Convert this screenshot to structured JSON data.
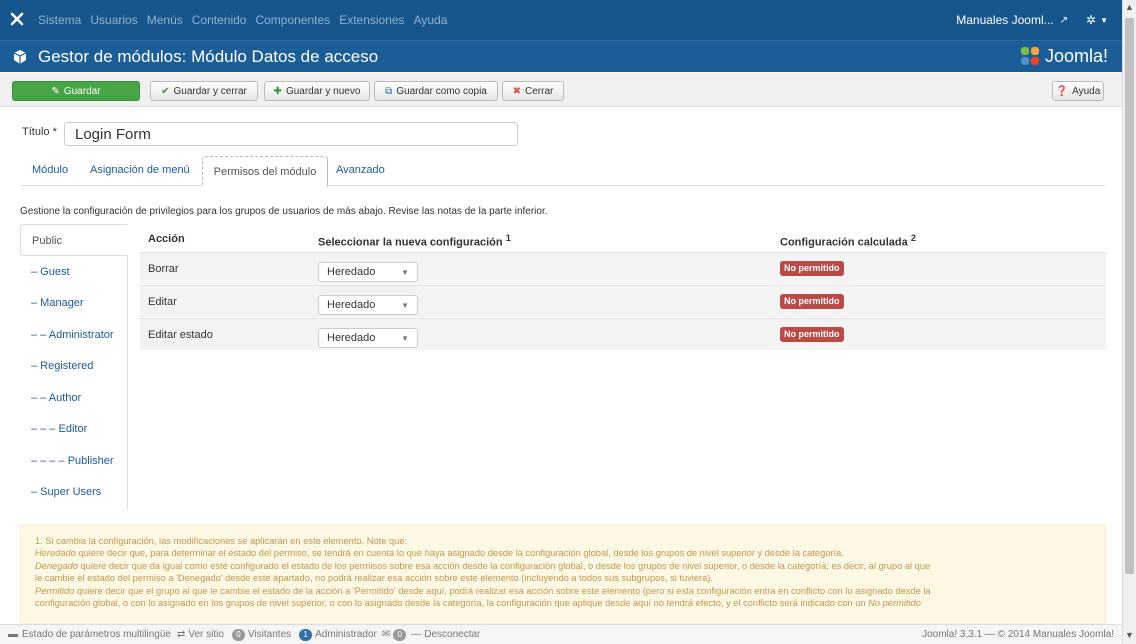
{
  "topnav": {
    "items": [
      "Sistema",
      "Usuarios",
      "Menús",
      "Contenido",
      "Componentes",
      "Extensiones",
      "Ayuda"
    ],
    "site_name": "Manuales Jooml...",
    "icons": [
      "joomla-x-icon",
      "external-link-icon",
      "gear-icon",
      "caret-down-icon"
    ]
  },
  "header": {
    "title": "Gestor de módulos: Módulo Datos de acceso",
    "brand": "Joomla!"
  },
  "toolbar": {
    "save_label": "Guardar",
    "save_close_label": "Guardar y cerrar",
    "save_new_label": "Guardar y nuevo",
    "save_copy_label": "Guardar como copia",
    "close_label": "Cerrar",
    "help_label": "Ayuda"
  },
  "form": {
    "title_label": "Título *",
    "title_value": "Login Form"
  },
  "tabs": {
    "items": [
      "Módulo",
      "Asignación de menú",
      "Permisos del módulo",
      "Avanzado"
    ],
    "active": "Permisos del módulo"
  },
  "permissions": {
    "description": "Gestione la configuración de privilegios para los grupos de usuarios de más abajo. Revise las notas de la parte inferior.",
    "groups": [
      "Public",
      "– Guest",
      "– Manager",
      "– – Administrator",
      "– Registered",
      "– – Author",
      "– – – Editor",
      "– – – – Publisher",
      "– Super Users"
    ],
    "active_group": "Public",
    "columns": {
      "action": "Acción",
      "new_setting": "Seleccionar la nueva configuración",
      "new_setting_sup": "1",
      "calculated": "Configuración calculada",
      "calculated_sup": "2"
    },
    "rows": [
      {
        "action": "Borrar",
        "select": "Heredado",
        "calculated": "No permitido"
      },
      {
        "action": "Editar",
        "select": "Heredado",
        "calculated": "No permitido"
      },
      {
        "action": "Editar estado",
        "select": "Heredado",
        "calculated": "No permitido"
      }
    ]
  },
  "notes": {
    "line1": "1. Si cambia la configuración, las modificaciones se aplicarán en este elemento. Note que:",
    "line2_em": "Heredado",
    "line2": " quiere decir que, para determinar el estado del permiso, se tendrá en cuenta lo que haya asignado desde la configuración global, desde los grupos de nivel superior y desde la categoría.",
    "line3_em": "Denegado",
    "line3": " quiere decir que da igual como esté configurado el estado de los permisos sobre esa acción desde la configuración global, o desde los grupos de nivel superior, o desde la categoría; es decir, al grupo al que",
    "line4": "le cambie el estado del permiso a 'Denegado' desde este apartado, no podrá realizar esa acción sobre este elemento (incluyendo a todos sus subgrupos, si tuviera).",
    "line5_em": "Permitido",
    "line5": " quiere decir que el grupo al que le cambie el estado de la acción a 'Permitido' desde aquí, podrá realizar esa acción sobre este elemento (pero si esta configuración entra en conflicto con lo asignado desde la",
    "line6": "configuración global, o con lo asignado en los grupos de nivel superior, o con lo asignado desde la categoría, la configuración que aplique desde aquí no tendrá efecto, y el conflicto será indicado con un",
    "line6_em": "No permitido"
  },
  "statusbar": {
    "multilang": "Estado de parámetros multilingüe",
    "view_site": "Ver sitio",
    "visitors_count": "0",
    "visitors_label": "Visitantes",
    "admin_count": "1",
    "admin_label": "Administrador",
    "messages_count": "0",
    "logout": "Desconectar",
    "version": "Joomla! 3.3.1 — © 2014 Manuales Joomla!"
  },
  "colors": {
    "topbar": "#17568c",
    "header": "#1b5d96",
    "save_button": "#46a546",
    "badge_danger": "#b94a48",
    "notes_bg": "#fcf8e3",
    "notes_text": "#c09853"
  }
}
